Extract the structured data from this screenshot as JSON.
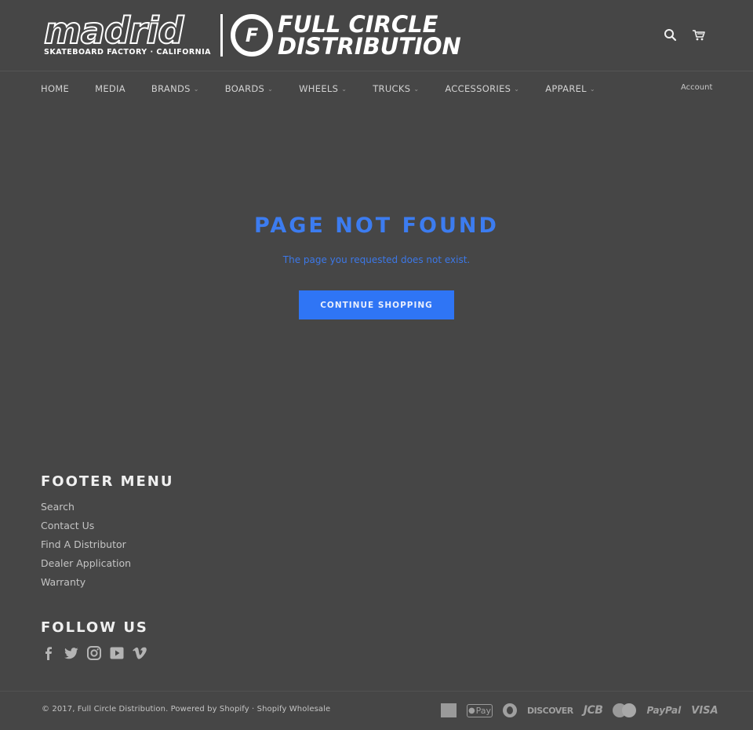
{
  "header": {
    "logo_madrid_word": "madrid",
    "logo_madrid_sub": "SKATEBOARD FACTORY · CALIFORNIA",
    "logo_circle_letter": "F",
    "logo_fcd_line1": "FULL CIRCLE",
    "logo_fcd_line2": "DISTRIBUTION",
    "search_icon": "search-icon",
    "cart_icon": "cart-icon"
  },
  "nav": {
    "items": [
      {
        "label": "HOME",
        "dropdown": false
      },
      {
        "label": "MEDIA",
        "dropdown": false
      },
      {
        "label": "BRANDS",
        "dropdown": true
      },
      {
        "label": "BOARDS",
        "dropdown": true
      },
      {
        "label": "WHEELS",
        "dropdown": true
      },
      {
        "label": "TRUCKS",
        "dropdown": true
      },
      {
        "label": "ACCESSORIES",
        "dropdown": true
      },
      {
        "label": "APPAREL",
        "dropdown": true
      }
    ],
    "chevron": "⌄",
    "account_label": "Account"
  },
  "main": {
    "title": "PAGE NOT FOUND",
    "subtitle": "The page you requested does not exist.",
    "button_label": "CONTINUE SHOPPING",
    "accent_color": "#3c7cf0",
    "button_color": "#2f75f5"
  },
  "footer": {
    "menu_title": "FOOTER MENU",
    "menu_items": [
      "Search",
      "Contact Us",
      "Find A Distributor",
      "Dealer Application",
      "Warranty"
    ],
    "follow_title": "FOLLOW US",
    "social": [
      "facebook-icon",
      "twitter-icon",
      "instagram-icon",
      "youtube-icon",
      "vimeo-icon"
    ],
    "copyright_prefix": "© 2017, ",
    "copyright_company": "Full Circle Distribution",
    "copyright_dot": ". ",
    "powered_by": "Powered by Shopify",
    "separator": " · ",
    "wholesale": "Shopify Wholesale",
    "payments": {
      "amex": "",
      "applepay": "Pay",
      "diners": "",
      "discover": "DISCOVER",
      "jcb": "JCB",
      "mastercard": "",
      "paypal": "PayPal",
      "visa": "VISA"
    }
  }
}
